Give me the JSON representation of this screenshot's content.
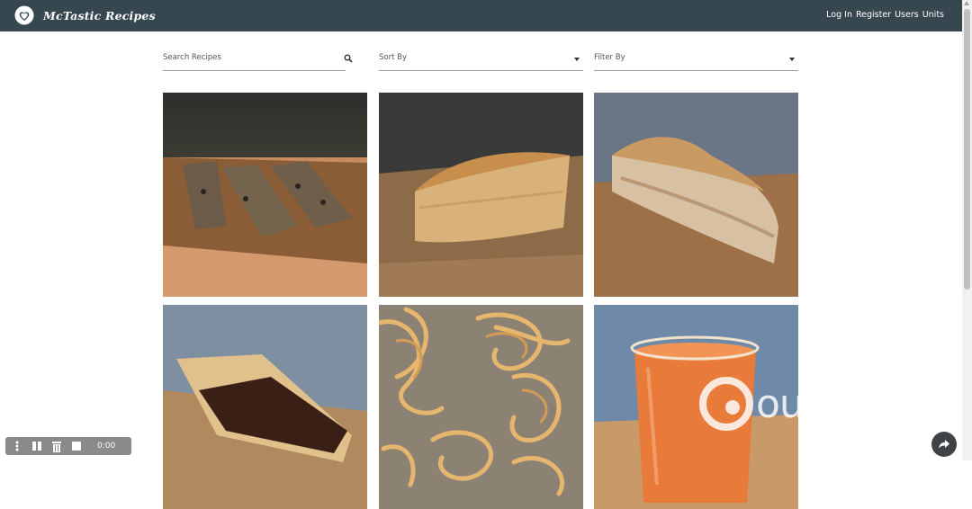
{
  "navbar": {
    "brand": "McTastic Recipes",
    "links": [
      "Log In",
      "Register",
      "Users",
      "Units"
    ],
    "background": "#37474f"
  },
  "search": {
    "label": "Search Recipes"
  },
  "sort": {
    "label": "Sort By"
  },
  "filter": {
    "label": "Filter By"
  },
  "recipes": [
    {
      "image": "granola-bars-photo"
    },
    {
      "image": "apple-cake-photo"
    },
    {
      "image": "apple-pie-photo"
    },
    {
      "image": "chocolate-tart-photo"
    },
    {
      "image": "fresh-pasta-photo"
    },
    {
      "image": "carrot-juice-photo"
    }
  ],
  "recorder": {
    "time": "0:00"
  },
  "watermark": {
    "text": "outklip"
  }
}
